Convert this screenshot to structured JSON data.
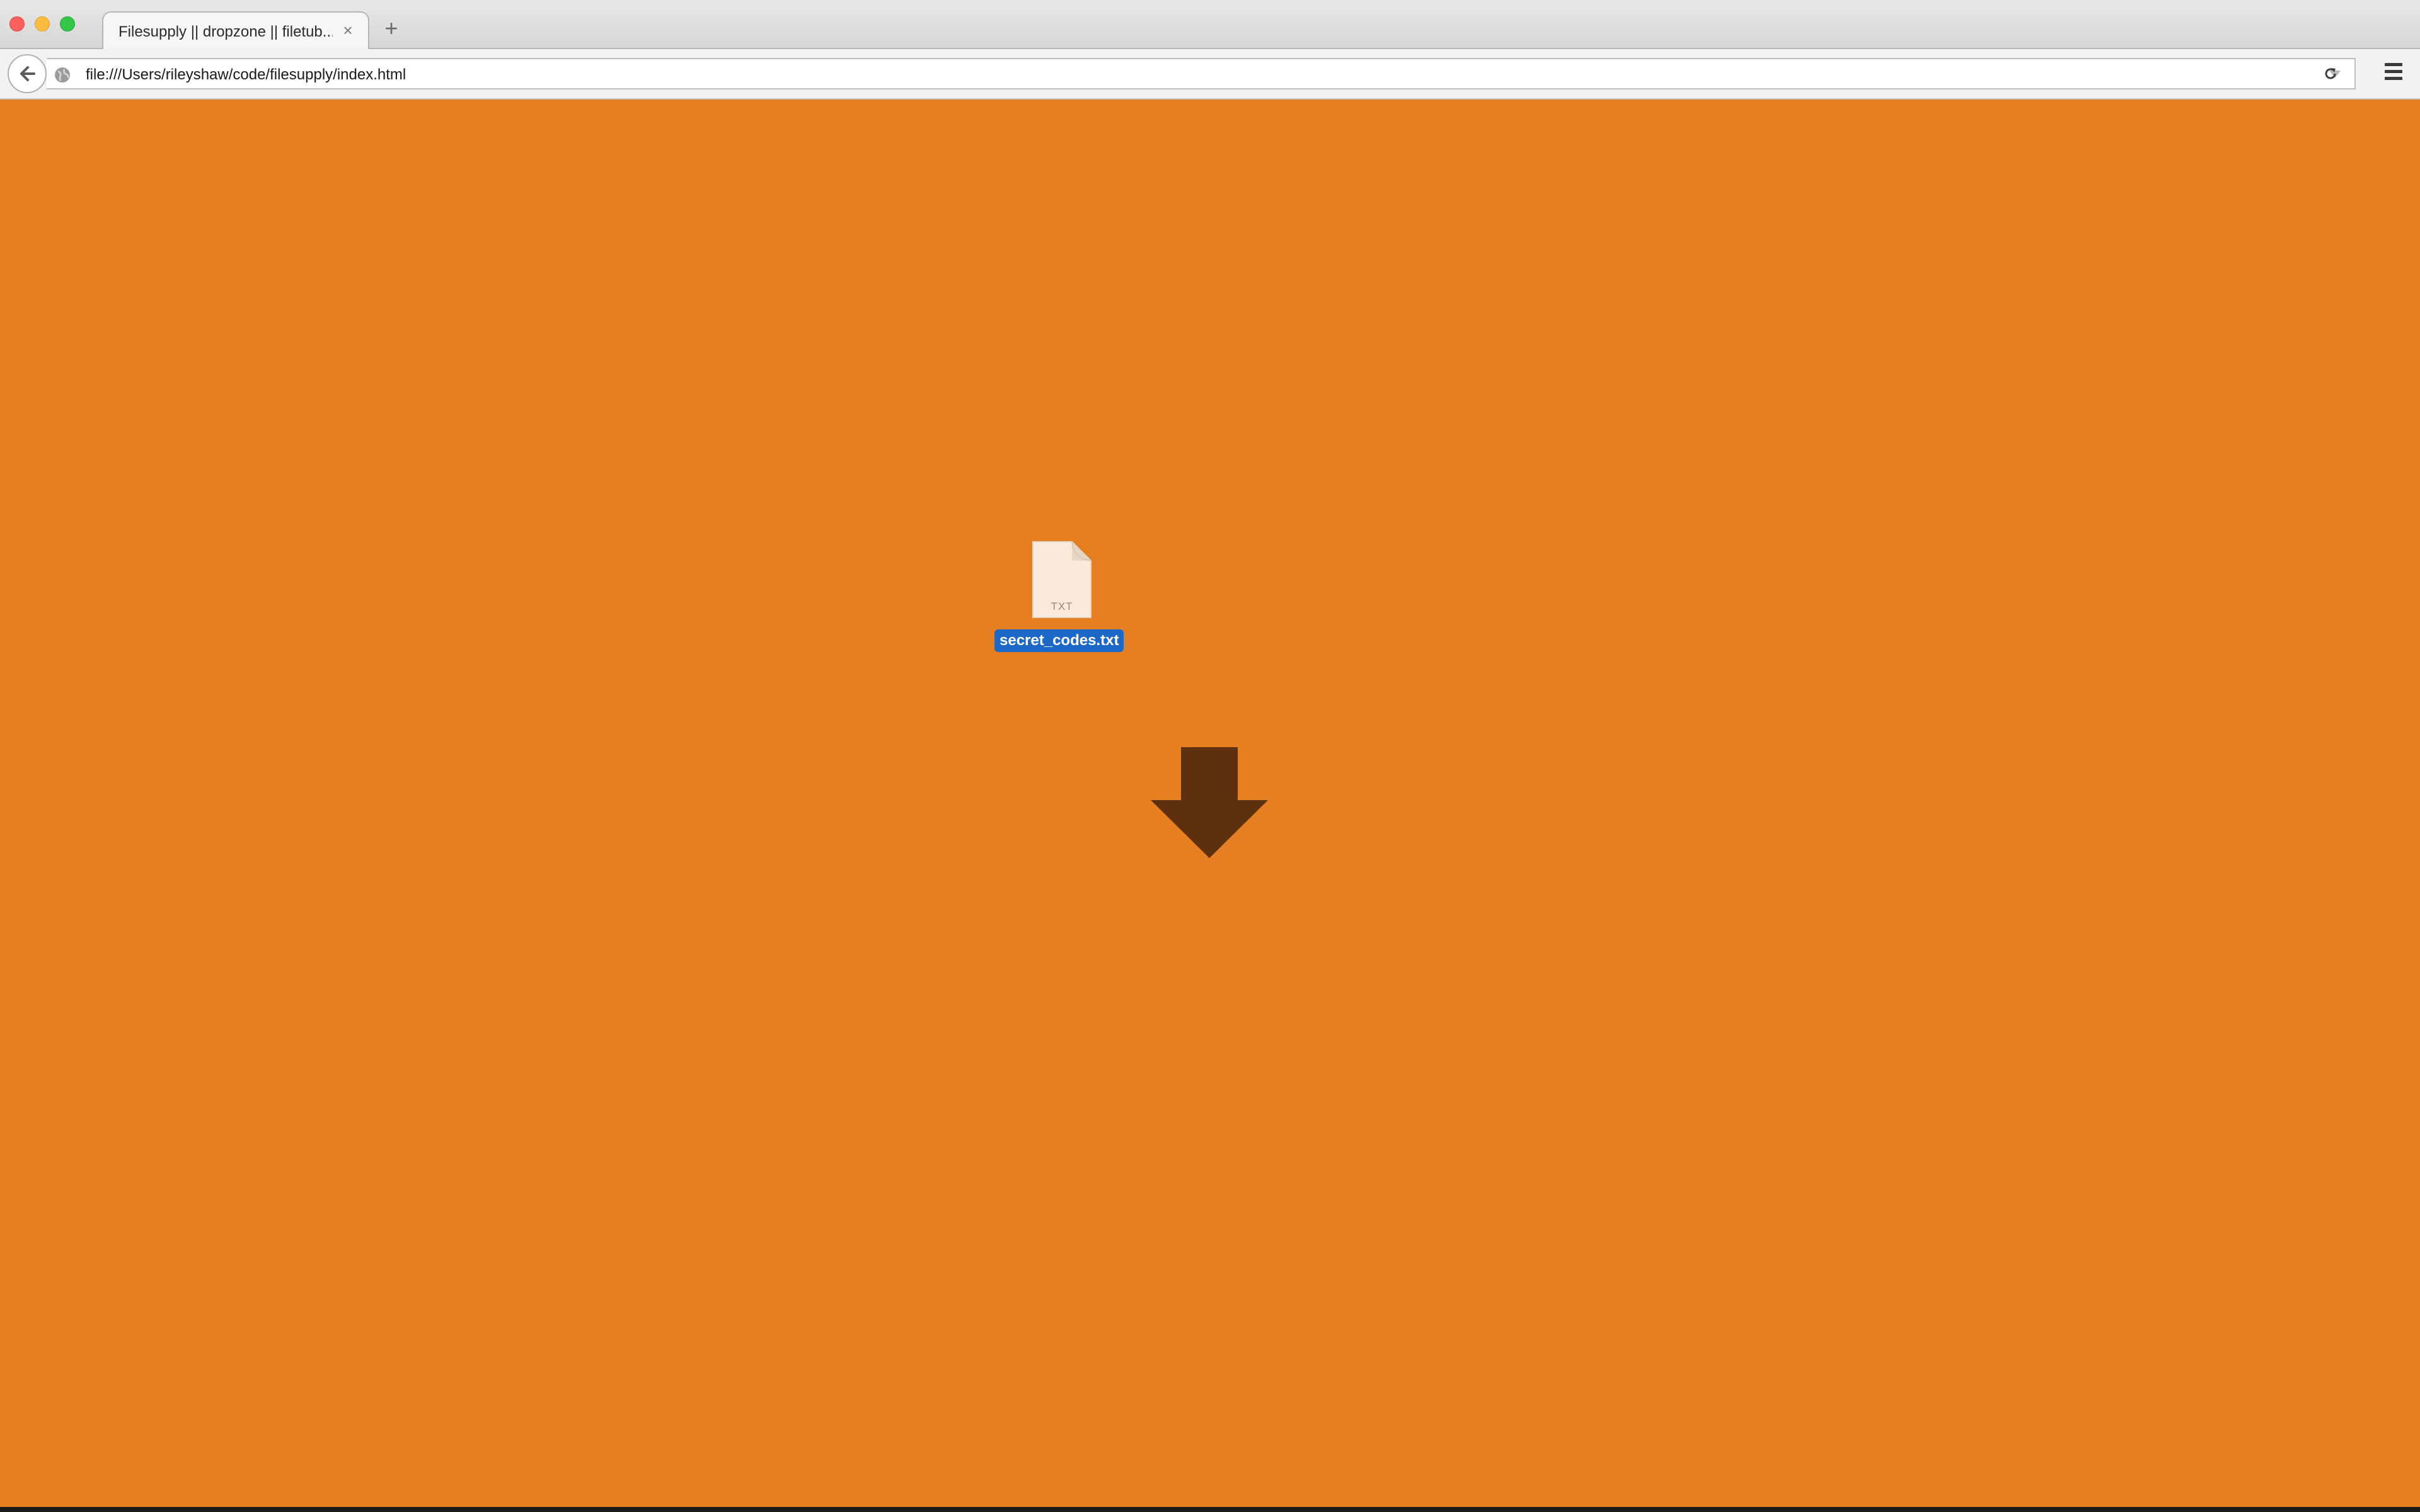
{
  "browser": {
    "tab": {
      "title": "Filesupply || dropzone || filetub...",
      "close_glyph": "×"
    },
    "new_tab_glyph": "+",
    "address": {
      "url": "file:///Users/rileyshaw/code/filesupply/index.html"
    }
  },
  "page": {
    "background_color": "#e67e22",
    "file": {
      "name": "secret_codes.txt",
      "extension": "TXT",
      "selected": true,
      "icon": "document-icon"
    },
    "drop_indicator": {
      "icon": "down-arrow-icon",
      "color": "#5e300e"
    }
  }
}
